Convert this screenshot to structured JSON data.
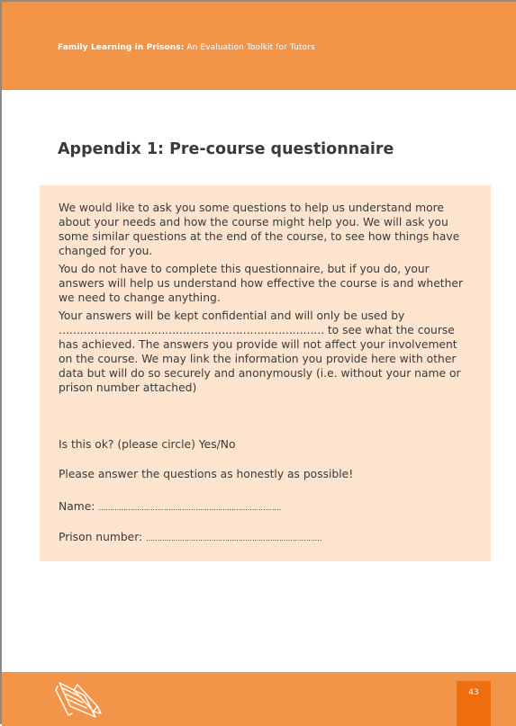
{
  "header": {
    "title_bold": "Family Learning in Prisons:",
    "title_rest": " An Evaluation Toolkit for Tutors"
  },
  "page_title": "Appendix 1: Pre-course questionnaire",
  "content": {
    "para1": "We would like to ask you some questions to help us understand more about your needs and how the course might help you. We will ask you some similar questions at the end of the course, to see how things have changed for you.",
    "para2": "You do not have to complete this questionnaire, but if you do, your answers will help us understand how effective the course is and whether we need to change anything.",
    "para3_start": "Your answers will be kept confidential and will only be used by ",
    "para3_dots": "…………………………………………………………………",
    "para3_end": " to see what the course has achieved. The answers you provide will not affect your involvement on the course. We may link the information you provide here with other data but will do so securely and anonymously (i.e. without your name or prison number attached)",
    "consent": "Is this ok? (please circle) Yes/No",
    "honesty": "Please answer the questions as honestly as possible!",
    "name_label": "Name:",
    "name_dots": "………………………………………………………………………",
    "prison_label": "Prison number:",
    "prison_dots": "……………………………………………………………………"
  },
  "footer": {
    "page_number": "43",
    "logo_icon": "pen-on-paper-icon"
  },
  "colors": {
    "header": "#f39549",
    "content_box": "#fde4cf",
    "page_number_box": "#ee6d0c",
    "text": "#3a3a3a"
  }
}
